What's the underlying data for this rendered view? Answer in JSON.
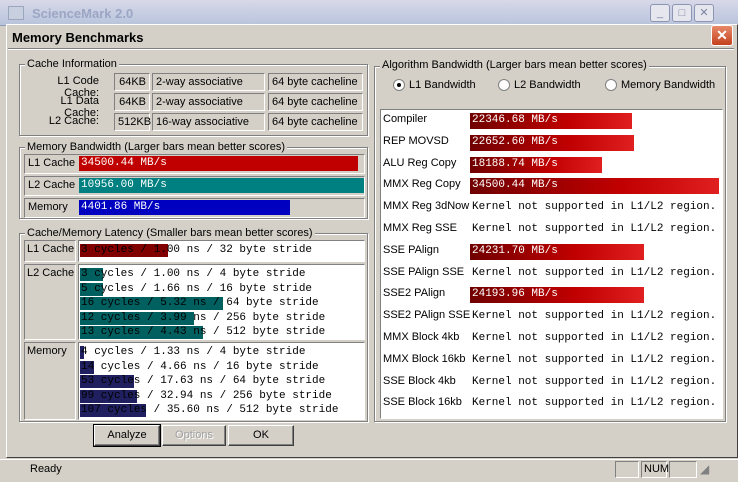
{
  "app_window": {
    "title": "ScienceMark 2.0"
  },
  "dialog": {
    "title": "Memory Benchmarks",
    "close_symbol": "✕"
  },
  "cache_info": {
    "title": "Cache Information",
    "rows": [
      {
        "label": "L1 Code Cache:",
        "size": "64KB",
        "assoc": "2-way associative",
        "line": "64 byte cacheline"
      },
      {
        "label": "L1 Data Cache:",
        "size": "64KB",
        "assoc": "2-way associative",
        "line": "64 byte cacheline"
      },
      {
        "label": "L2 Cache:",
        "size": "512KB",
        "assoc": "16-way associative",
        "line": "64 byte cacheline"
      }
    ]
  },
  "memory_bandwidth": {
    "title": "Memory Bandwidth (Larger bars mean better scores)",
    "rows": [
      {
        "label": "L1 Cache",
        "value": "34500.44 MB/s",
        "fill": 0.98,
        "color": "#c00000"
      },
      {
        "label": "L2 Cache",
        "value": "10956.00 MB/s",
        "fill": 1.0,
        "color": "#008080"
      },
      {
        "label": "Memory",
        "value": "4401.86 MB/s",
        "fill": 0.74,
        "color": "#0000c0"
      }
    ]
  },
  "cache_latency": {
    "title": "Cache/Memory Latency (Smaller bars mean better scores)",
    "groups": [
      {
        "label": "L1 Cache",
        "color": "#800000",
        "lines": [
          {
            "text": "3 cycles / 1.00 ns / 32 byte stride",
            "fill": 0.31
          }
        ]
      },
      {
        "label": "L2 Cache",
        "color": "#006060",
        "lines": [
          {
            "text": "3 cycles / 1.00 ns / 4 byte stride",
            "fill": 0.08
          },
          {
            "text": "5 cycles / 1.66 ns / 16 byte stride",
            "fill": 0.08
          },
          {
            "text": "16 cycles / 5.32 ns / 64 byte stride",
            "fill": 0.5
          },
          {
            "text": "12 cycles / 3.99 ns / 256 byte stride",
            "fill": 0.4
          },
          {
            "text": "13 cycles / 4.43 ns / 512 byte stride",
            "fill": 0.43
          }
        ]
      },
      {
        "label": "Memory",
        "color": "#202060",
        "lines": [
          {
            "text": "4 cycles / 1.33 ns / 4 byte stride",
            "fill": 0.01
          },
          {
            "text": "14 cycles / 4.66 ns / 16 byte stride",
            "fill": 0.05
          },
          {
            "text": "53 cycles / 17.63 ns / 64 byte stride",
            "fill": 0.19
          },
          {
            "text": "99 cycles / 32.94 ns / 256 byte stride",
            "fill": 0.2
          },
          {
            "text": "107 cycles / 35.60 ns / 512 byte stride",
            "fill": 0.23
          }
        ]
      }
    ]
  },
  "buttons": {
    "analyze": "Analyze",
    "options": "Options",
    "ok": "OK"
  },
  "algorithm_bandwidth": {
    "title": "Algorithm Bandwidth (Larger bars mean better scores)",
    "radios": [
      {
        "label": "L1 Bandwidth",
        "selected": true
      },
      {
        "label": "L2 Bandwidth",
        "selected": false
      },
      {
        "label": "Memory Bandwidth",
        "selected": false
      }
    ],
    "rows": [
      {
        "label": "Compiler",
        "value": "22346.68 MB/s",
        "fill": 0.65
      },
      {
        "label": "REP MOVSD",
        "value": "22652.60 MB/s",
        "fill": 0.66
      },
      {
        "label": "ALU Reg Copy",
        "value": "18188.74 MB/s",
        "fill": 0.53
      },
      {
        "label": "MMX Reg Copy",
        "value": "34500.44 MB/s",
        "fill": 1.0
      },
      {
        "label": "MMX Reg 3dNow",
        "value": "Kernel not supported in L1/L2 region.",
        "fill": 0
      },
      {
        "label": "MMX Reg SSE",
        "value": "Kernel not supported in L1/L2 region.",
        "fill": 0
      },
      {
        "label": "SSE PAlign",
        "value": "24231.70 MB/s",
        "fill": 0.7
      },
      {
        "label": "SSE PAlign SSE",
        "value": "Kernel not supported in L1/L2 region.",
        "fill": 0
      },
      {
        "label": "SSE2 PAlign",
        "value": "24193.96 MB/s",
        "fill": 0.7
      },
      {
        "label": "SSE2 PAlign SSE",
        "value": "Kernel not supported in L1/L2 region.",
        "fill": 0
      },
      {
        "label": "MMX Block 4kb",
        "value": "Kernel not supported in L1/L2 region.",
        "fill": 0
      },
      {
        "label": "MMX Block 16kb",
        "value": "Kernel not supported in L1/L2 region.",
        "fill": 0
      },
      {
        "label": "SSE Block 4kb",
        "value": "Kernel not supported in L1/L2 region.",
        "fill": 0
      },
      {
        "label": "SSE Block 16kb",
        "value": "Kernel not supported in L1/L2 region.",
        "fill": 0
      }
    ]
  },
  "statusbar": {
    "text": "Ready",
    "num": "NUM"
  }
}
